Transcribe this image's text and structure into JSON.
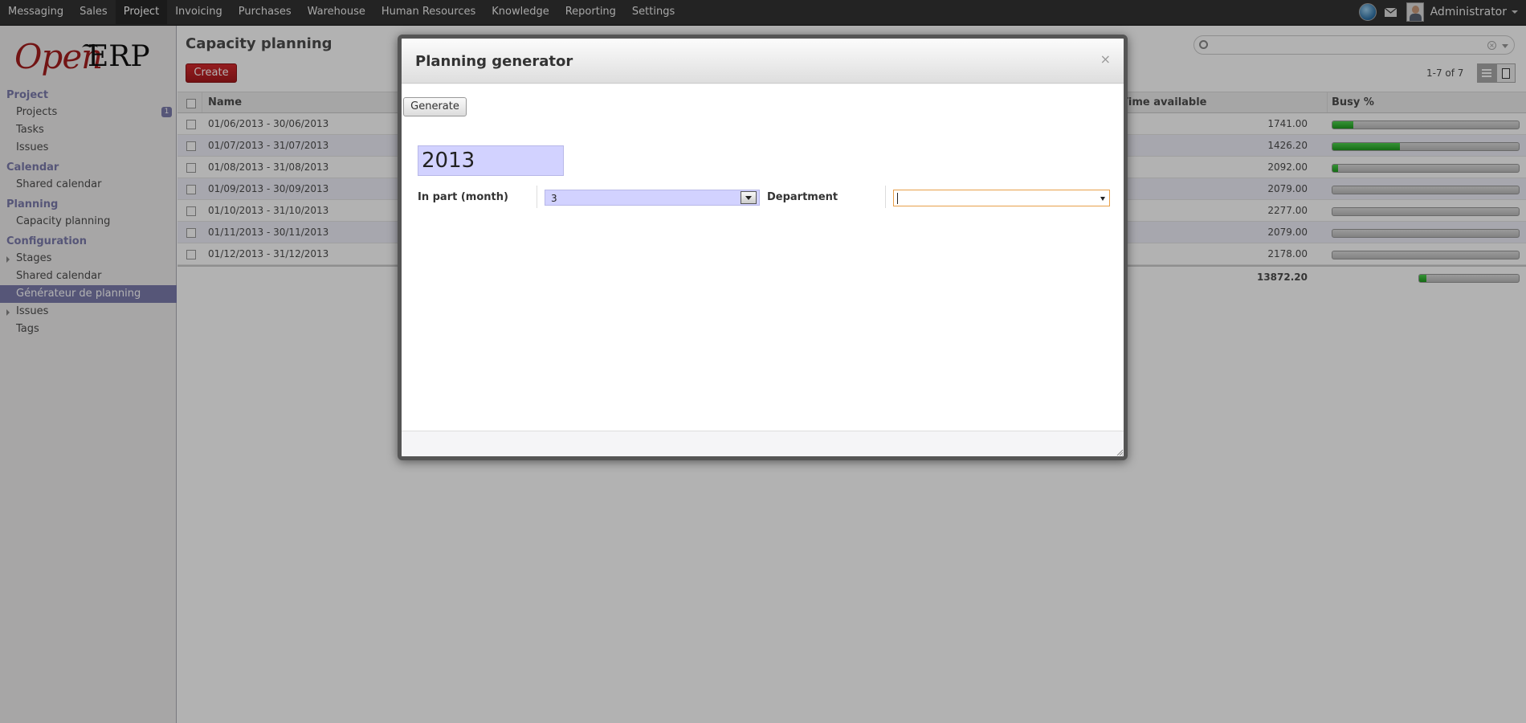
{
  "topbar": {
    "menu": [
      "Messaging",
      "Sales",
      "Project",
      "Invoicing",
      "Purchases",
      "Warehouse",
      "Human Resources",
      "Knowledge",
      "Reporting",
      "Settings"
    ],
    "active_menu": "Project",
    "user_name": "Administrator",
    "icons": [
      "globe-icon",
      "mail-icon",
      "avatar-icon",
      "chevron-down-icon"
    ]
  },
  "sidebar": {
    "logo": {
      "part1": "Open",
      "part2": "ERP"
    },
    "sections": [
      {
        "title": "Project",
        "items": [
          {
            "label": "Projects",
            "badge": "1"
          },
          {
            "label": "Tasks"
          },
          {
            "label": "Issues"
          }
        ]
      },
      {
        "title": "Calendar",
        "items": [
          {
            "label": "Shared calendar"
          }
        ]
      },
      {
        "title": "Planning",
        "items": [
          {
            "label": "Capacity planning"
          }
        ]
      },
      {
        "title": "Configuration",
        "items": [
          {
            "label": "Stages",
            "expandable": true
          },
          {
            "label": "Shared calendar"
          },
          {
            "label": "Générateur de planning",
            "selected": true
          },
          {
            "label": "Issues",
            "expandable": true
          },
          {
            "label": "Tags"
          }
        ]
      }
    ]
  },
  "main": {
    "title": "Capacity planning",
    "create_label": "Create",
    "pager": "1-7 of 7",
    "table": {
      "headers": {
        "name": "Name",
        "time_available": "Time available",
        "busy": "Busy %"
      },
      "rows": [
        {
          "name": "01/06/2013 - 30/06/2013",
          "time": "1741.00",
          "busy": 11
        },
        {
          "name": "01/07/2013 - 31/07/2013",
          "time": "1426.20",
          "busy": 36
        },
        {
          "name": "01/08/2013 - 31/08/2013",
          "time": "2092.00",
          "busy": 3
        },
        {
          "name": "01/09/2013 - 30/09/2013",
          "time": "2079.00",
          "busy": 0
        },
        {
          "name": "01/10/2013 - 31/10/2013",
          "time": "2277.00",
          "busy": 0
        },
        {
          "name": "01/11/2013 - 30/11/2013",
          "time": "2079.00",
          "busy": 0
        },
        {
          "name": "01/12/2013 - 31/12/2013",
          "time": "2178.00",
          "busy": 0
        }
      ],
      "footer": {
        "time_total": "13872.20",
        "busy": 7
      }
    }
  },
  "modal": {
    "title": "Planning generator",
    "close": "×",
    "generate_label": "Generate",
    "year": "2013",
    "in_part_label": "In part (month)",
    "in_part_value": "3",
    "department_label": "Department",
    "department_value": ""
  },
  "colors": {
    "accent": "#7c7bad",
    "create_button": "#c1232a",
    "progress": "#2fb82f",
    "field_required": "#d2d2ff"
  }
}
